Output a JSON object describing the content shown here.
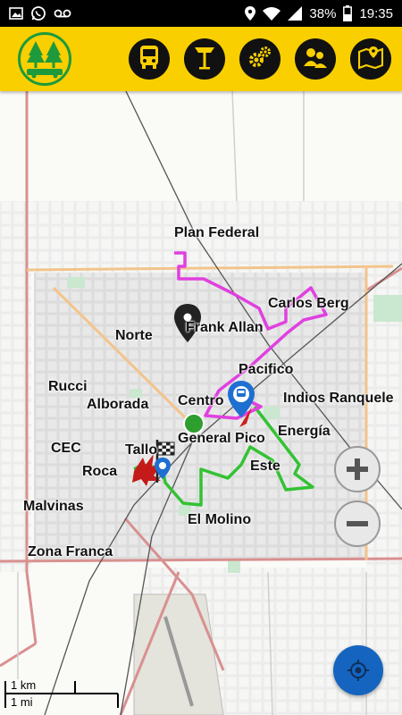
{
  "statusbar": {
    "battery": "38%",
    "time": "19:35",
    "left_icons": [
      "image-icon",
      "whatsapp-icon",
      "voicemail-icon"
    ],
    "right_icons": [
      "location-icon",
      "wifi-icon",
      "signal-icon",
      "battery-icon"
    ]
  },
  "appbar": {
    "background": "#f9cf00",
    "logo": "bus-trees-logo",
    "buttons": [
      "bus-icon",
      "bus-stop-icon",
      "settings-gears-icon",
      "users-icon",
      "map-pin-icon"
    ]
  },
  "map": {
    "labels": {
      "plan_federal": "Plan Federal",
      "carlos_berg": "Carlos Berg",
      "frank_allan": "Frank Allan",
      "norte": "Norte",
      "pacifico": "Pacifico",
      "rucci": "Rucci",
      "alborada": "Alborada",
      "centro": "Centro",
      "indios_ranquele": "Indios Ranquele",
      "general_pico": "General Pico",
      "energia": "Energía",
      "cec": "CEC",
      "tallo": "Tallo",
      "este": "Este",
      "roca": "Roca",
      "malvinas": "Malvinas",
      "el_molino": "El Molino",
      "zona_franca": "Zona Franca"
    },
    "route_colors": {
      "magenta_line": "#e040e0",
      "green_line": "#33c233",
      "road_major": "#f5b97a",
      "road_red": "#d98a8a"
    },
    "scale": {
      "km": "1 km",
      "mi": "1 mi"
    }
  },
  "controls": {
    "zoom_in": "+",
    "zoom_out": "−",
    "locate": "crosshair-icon"
  }
}
